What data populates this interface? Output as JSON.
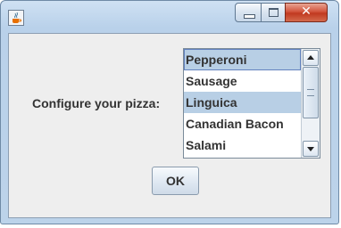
{
  "window": {
    "title": ""
  },
  "titlebar": {
    "icon": "java-cup-icon",
    "buttons": {
      "minimize": "minimize-icon",
      "maximize": "maximize-icon",
      "close": "close-icon"
    }
  },
  "form": {
    "label": "Configure your pizza:",
    "list": {
      "items": [
        "Pepperoni",
        "Sausage",
        "Linguica",
        "Canadian Bacon",
        "Salami"
      ],
      "selected_items": [
        "Pepperoni",
        "Linguica"
      ],
      "focused_item": "Pepperoni"
    },
    "ok_label": "OK"
  },
  "colors": {
    "selection": "#b8cfe5",
    "focus_border": "#6382bf",
    "close_button": "#c1391f",
    "client_background": "#eeeeee"
  }
}
